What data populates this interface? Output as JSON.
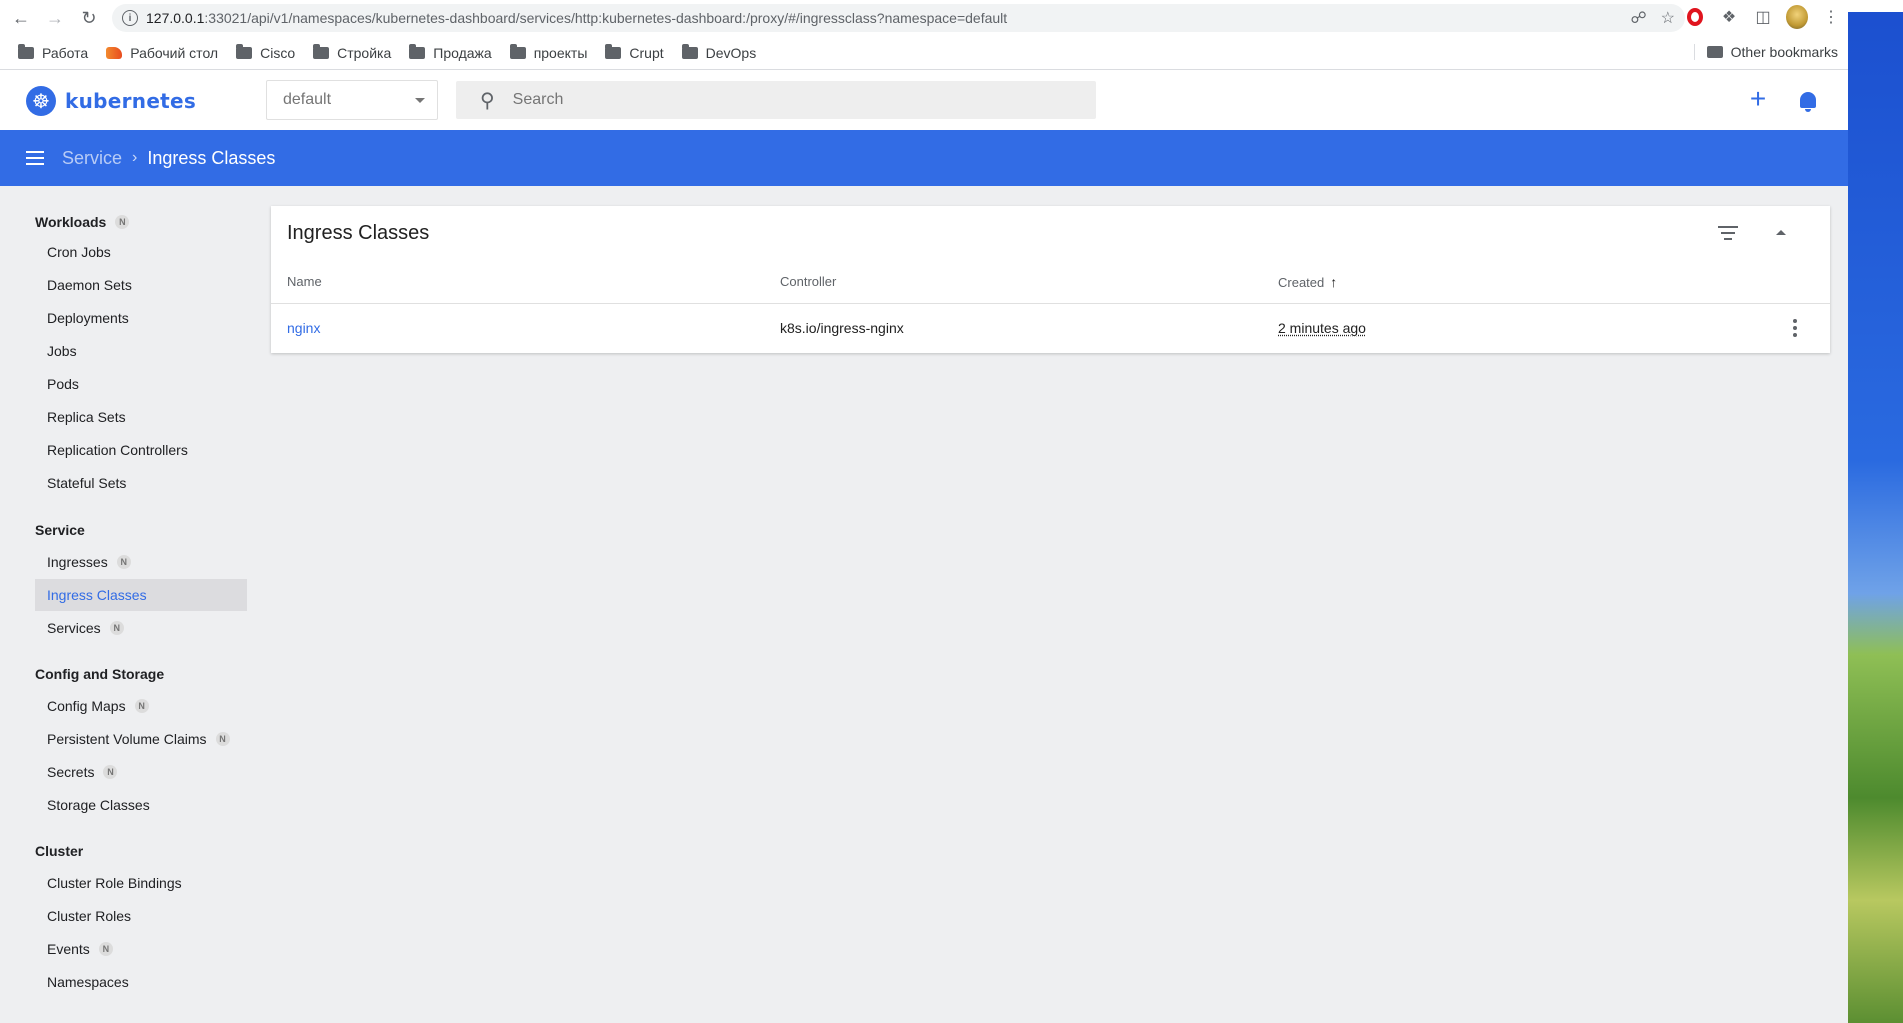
{
  "browser": {
    "url_host": "127.0.0.1",
    "url_rest": ":33021/api/v1/namespaces/kubernetes-dashboard/services/http:kubernetes-dashboard:/proxy/#/ingressclass?namespace=default",
    "bookmarks": [
      "Работа",
      "Рабочий стол",
      "Cisco",
      "Стройка",
      "Продажа",
      "проекты",
      "Crupt",
      "DevOps"
    ],
    "other_bookmarks": "Other bookmarks"
  },
  "app": {
    "brand": "kubernetes",
    "namespace": "default",
    "search_placeholder": "Search",
    "accent": "#326ce5"
  },
  "breadcrumb": {
    "parent": "Service",
    "current": "Ingress Classes"
  },
  "sidebar": {
    "groups": [
      {
        "label": "Workloads",
        "badge": "N"
      },
      {
        "label": "Service"
      },
      {
        "label": "Config and Storage"
      },
      {
        "label": "Cluster"
      }
    ],
    "items": [
      {
        "label": "Cron Jobs"
      },
      {
        "label": "Daemon Sets"
      },
      {
        "label": "Deployments"
      },
      {
        "label": "Jobs"
      },
      {
        "label": "Pods"
      },
      {
        "label": "Replica Sets"
      },
      {
        "label": "Replication Controllers"
      },
      {
        "label": "Stateful Sets"
      },
      {
        "label": "Ingresses",
        "badge": "N"
      },
      {
        "label": "Ingress Classes",
        "active": true
      },
      {
        "label": "Services",
        "badge": "N"
      },
      {
        "label": "Config Maps",
        "badge": "N"
      },
      {
        "label": "Persistent Volume Claims",
        "badge": "N"
      },
      {
        "label": "Secrets",
        "badge": "N"
      },
      {
        "label": "Storage Classes"
      },
      {
        "label": "Cluster Role Bindings"
      },
      {
        "label": "Cluster Roles"
      },
      {
        "label": "Events",
        "badge": "N"
      },
      {
        "label": "Namespaces"
      }
    ]
  },
  "card": {
    "title": "Ingress Classes",
    "columns": [
      "Name",
      "Controller",
      "Created"
    ],
    "rows": [
      {
        "name": "nginx",
        "controller": "k8s.io/ingress-nginx",
        "created": "2 minutes ago"
      }
    ]
  }
}
